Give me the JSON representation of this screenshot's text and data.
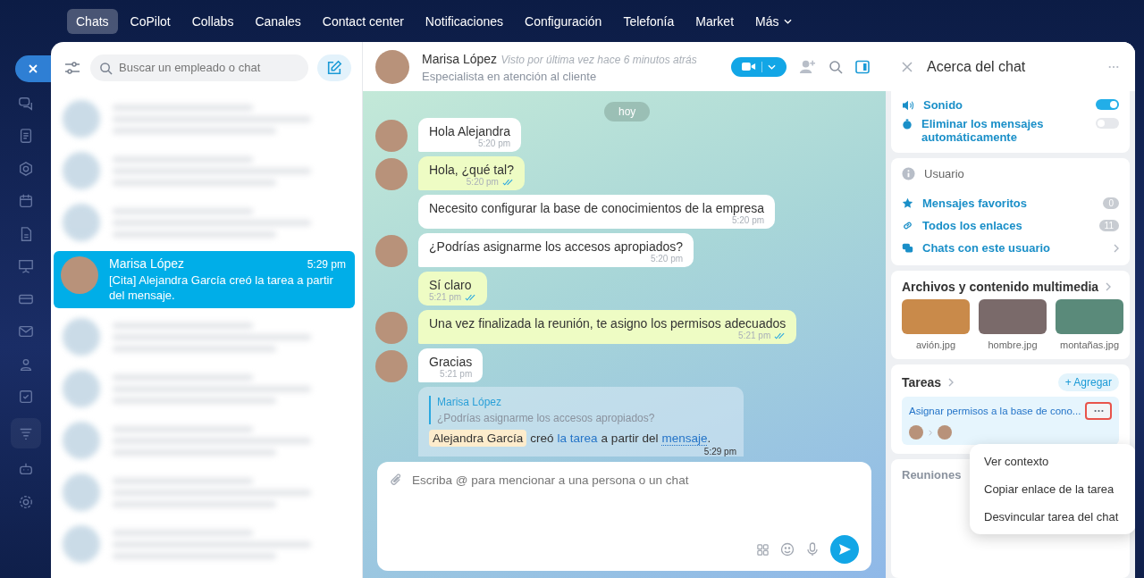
{
  "top_nav": {
    "items": [
      {
        "label": "Chats",
        "selected": true
      },
      {
        "label": "CoPilot",
        "selected": false
      },
      {
        "label": "Collabs",
        "selected": false
      },
      {
        "label": "Canales",
        "selected": false
      },
      {
        "label": "Contact center",
        "selected": false
      },
      {
        "label": "Notificaciones",
        "selected": false
      },
      {
        "label": "Configuración",
        "selected": false
      },
      {
        "label": "Telefonía",
        "selected": false
      },
      {
        "label": "Market",
        "selected": false
      },
      {
        "label": "Más",
        "selected": false,
        "dropdown": true
      }
    ]
  },
  "rail": [
    {
      "kind": "chat",
      "selected": false
    },
    {
      "kind": "document",
      "selected": false
    },
    {
      "kind": "hexagon",
      "selected": false
    },
    {
      "kind": "calendar",
      "selected": false
    },
    {
      "kind": "file",
      "selected": false
    },
    {
      "kind": "presentation",
      "selected": false
    },
    {
      "kind": "card",
      "selected": false
    },
    {
      "kind": "mail",
      "selected": false
    },
    {
      "kind": "people",
      "selected": false
    },
    {
      "kind": "checkbox",
      "selected": false
    },
    {
      "kind": "filter",
      "selected": true
    },
    {
      "kind": "robot",
      "selected": false
    },
    {
      "kind": "gear",
      "selected": false
    }
  ],
  "chat_list": {
    "search": {
      "placeholder": "Buscar un empleado o chat"
    },
    "items": [
      {
        "kind": "blurred"
      },
      {
        "kind": "blurred"
      },
      {
        "kind": "blurred"
      },
      {
        "kind": "chat",
        "selected": true,
        "name": "Marisa López",
        "time": "5:29 pm",
        "preview": "[Cita] Alejandra García creó la tarea a partir del mensaje."
      },
      {
        "kind": "blurred"
      },
      {
        "kind": "blurred"
      },
      {
        "kind": "blurred"
      },
      {
        "kind": "blurred"
      },
      {
        "kind": "blurred"
      }
    ]
  },
  "chat": {
    "name": "Marisa López",
    "last_seen": "Visto por última vez hace 6 minutos atrás",
    "role": "Especialista en atención al cliente",
    "date_badge": "hoy",
    "messages": [
      {
        "kind": "incoming",
        "avatar": true,
        "text": "Hola Alejandra",
        "time": "5:20 pm"
      },
      {
        "kind": "outgoing",
        "avatar": true,
        "text": "Hola, ¿qué tal?",
        "time": "5:20 pm",
        "read": true
      },
      {
        "kind": "incoming",
        "avatar": false,
        "text": "Necesito configurar la base de conocimientos de la empresa",
        "time": "5:20 pm"
      },
      {
        "kind": "incoming",
        "avatar": true,
        "text": "¿Podrías asignarme los accesos apropiados?",
        "time": "5:20 pm"
      },
      {
        "kind": "outgoing",
        "avatar": false,
        "text": "Sí claro",
        "time": "5:21 pm",
        "read": true
      },
      {
        "kind": "outgoing",
        "avatar": true,
        "text": "Una vez finalizada la reunión, te asigno los permisos adecuados",
        "time": "5:21 pm",
        "read": true
      },
      {
        "kind": "incoming",
        "avatar": true,
        "text": "Gracias",
        "time": "5:21 pm"
      },
      {
        "kind": "system",
        "avatar": false,
        "quote_author": "Marisa López",
        "quote_text": "¿Podrías asignarme los accesos apropiados?",
        "mention": "Alejandra García",
        "parts": [
          "creó",
          "la tarea",
          "a partir del",
          "mensaje",
          "."
        ],
        "time": "5:29 pm"
      }
    ],
    "composer": {
      "placeholder": "Escriba @ para mencionar a una persona o un chat"
    }
  },
  "about": {
    "title": "Acerca del chat",
    "settings": [
      {
        "label": "Sonido",
        "on": true,
        "kind": "sound"
      },
      {
        "label": "Eliminar los mensajes automáticamente",
        "on": false,
        "kind": "timer"
      }
    ],
    "user_label": "Usuario",
    "links": [
      {
        "label": "Mensajes favoritos",
        "count": "0",
        "kind": "star"
      },
      {
        "label": "Todos los enlaces",
        "count": "11",
        "kind": "link"
      },
      {
        "label": "Chats con este usuario",
        "kind": "chats"
      }
    ],
    "media_title": "Archivos y contenido multimedia",
    "media": [
      {
        "name": "avión.jpg",
        "color": "#c98a4a"
      },
      {
        "name": "hombre.jpg",
        "color": "#7a6a6a"
      },
      {
        "name": "montañas.jpg",
        "color": "#5a8a7a"
      }
    ],
    "tasks_title": "Tareas",
    "add_label": "+ Agregar",
    "task": {
      "title": "Asignar permisos a la base de cono..."
    },
    "meetings_title": "Reuniones",
    "menu": [
      "Ver contexto",
      "Copiar enlace de la tarea",
      "Desvincular tarea del chat"
    ]
  }
}
